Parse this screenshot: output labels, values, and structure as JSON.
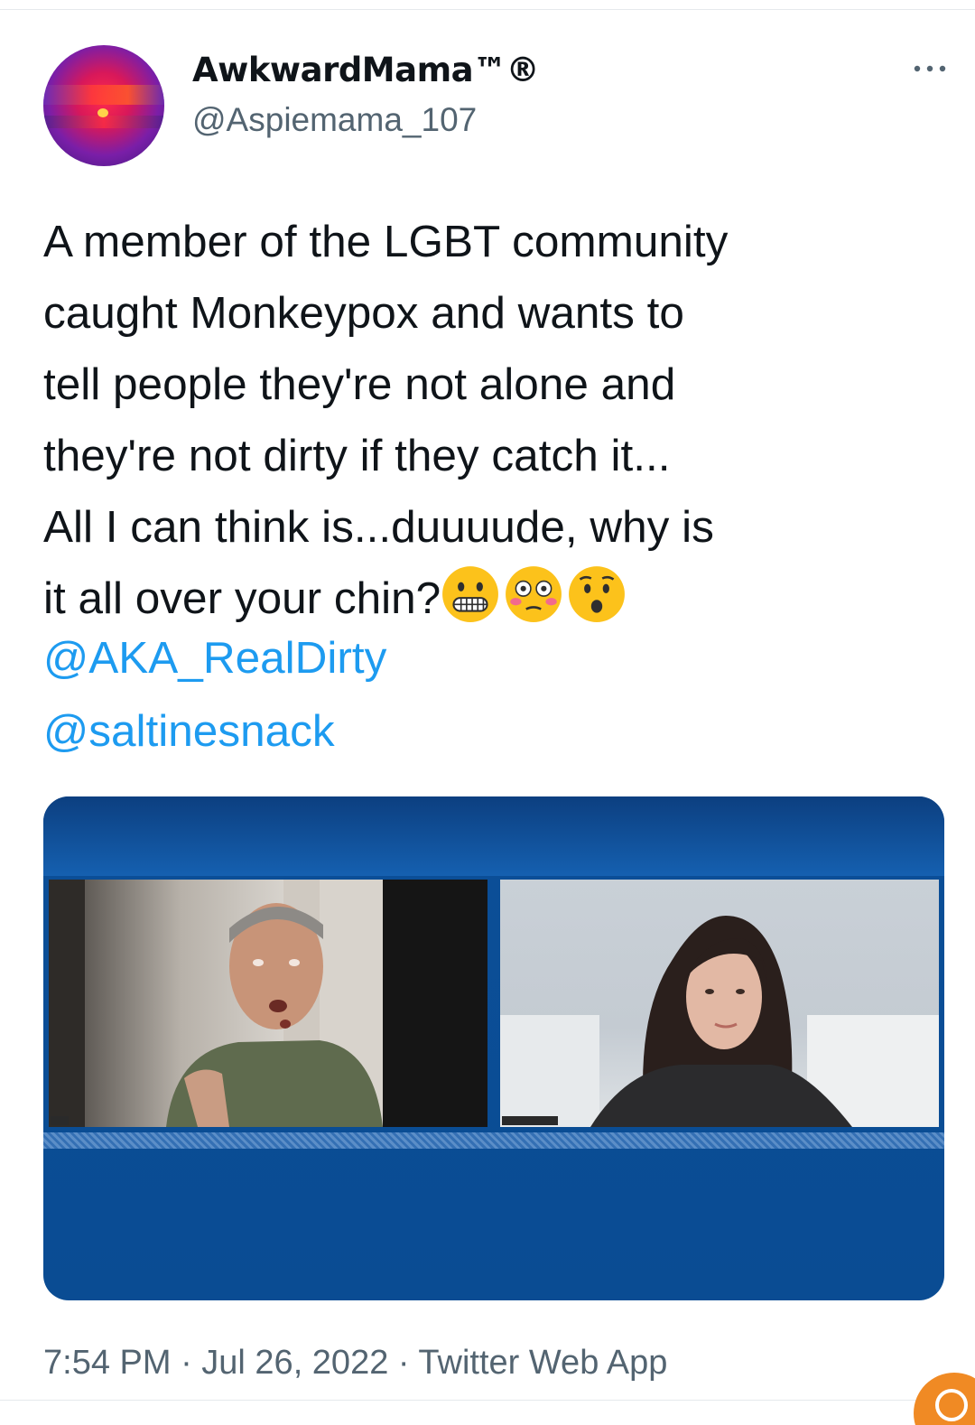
{
  "author": {
    "display_name": "AwkwardMama™®",
    "handle": "@Aspiemama_107",
    "avatar_icon": "avatar-image"
  },
  "menu": {
    "more_icon": "more-horizontal-icon"
  },
  "tweet": {
    "lines": [
      "A member of the LGBT community",
      "caught Monkeypox and wants to",
      "tell people they're not alone and",
      "they're not dirty if they catch it...",
      "All I can think is...duuuude, why is",
      "it all over your chin?"
    ],
    "emojis": [
      "grimacing-face-emoji",
      "flushed-face-emoji",
      "hushed-face-emoji"
    ],
    "mentions": [
      "@AKA_RealDirty",
      "@saltinesnack"
    ]
  },
  "media": {
    "type": "video",
    "description_icon": "video-call-thumbnail"
  },
  "footer": {
    "timestamp": "7:54 PM · Jul 26, 2022 · Twitter Web App"
  },
  "colors": {
    "text": "#0f1419",
    "secondary": "#536471",
    "link": "#1d9bf0",
    "media_blue": "#0b4e97",
    "badge": "#f08a24"
  }
}
